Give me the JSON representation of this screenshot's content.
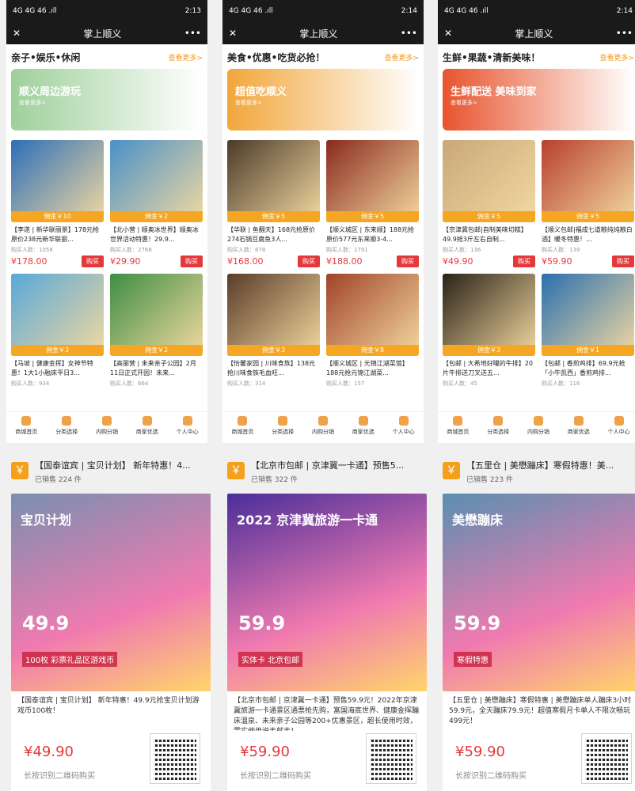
{
  "status_bar": {
    "times": [
      "2:13",
      "2:14",
      "2:14"
    ],
    "signal": "4G 4G 46 .ıll"
  },
  "window": {
    "title": "掌上顺义",
    "close": "✕",
    "more": "•••"
  },
  "columns": [
    {
      "section": "亲子•娱乐•休闲",
      "more": "查看更多>",
      "banner": {
        "title": "顺义周边游玩",
        "sub": "查看更多>",
        "color": "#9ed09a"
      },
      "products": [
        {
          "tag": "佣金￥10",
          "name": "【李遂 | 新华联丽景】178元抢原价238元新华联丽...",
          "sold": "购买人数：1058",
          "price": "¥178.00",
          "buy": "购买",
          "color": "#2c6fb8"
        },
        {
          "tag": "佣金￥2",
          "name": "【北小营 | 顺奥冰世界】顺奥冰世界活动特惠！29.9...",
          "sold": "购买人数：2768",
          "price": "¥29.90",
          "buy": "购买",
          "color": "#4a90c8"
        },
        {
          "tag": "佣金￥3",
          "name": "【马坡 | 健康金挥】女神节特惠！1大1小融床平日3...",
          "sold": "购买人数：934",
          "price": "",
          "buy": "",
          "color": "#58a8d8"
        },
        {
          "tag": "佣金￥2",
          "name": "【高丽营 | 未来亲子公园】2月11日正式开园！未来...",
          "sold": "购买人数：664",
          "price": "",
          "buy": "",
          "color": "#3e8e44"
        }
      ]
    },
    {
      "section": "美食•优惠•吃货必抢！",
      "more": "查看更多>",
      "banner": {
        "title": "超值吃顺义",
        "sub": "查看更多>",
        "color": "#f2a63b"
      },
      "products": [
        {
          "tag": "佣金￥5",
          "name": "【华联 | 鱼翻天】168元抢原价274石锅豆腐鱼3人...",
          "sold": "购买人数：678",
          "price": "¥168.00",
          "buy": "购买",
          "color": "#4b3a2a"
        },
        {
          "tag": "佣金￥5",
          "name": "【顺义城区 | 东来顺】188元抢原价577元东来顺3-4...",
          "sold": "购买人数：1791",
          "price": "¥188.00",
          "buy": "购买",
          "color": "#8a2a1e"
        },
        {
          "tag": "佣金￥3",
          "name": "【怡馨家园 | 川味食族】138元抢川味食族毛血旺...",
          "sold": "购买人数：314",
          "price": "",
          "buy": "",
          "color": "#5a3c2a"
        },
        {
          "tag": "佣金￥8",
          "name": "【顺义城区 | 元锦江湖菜馆】188元抢元锦江湖菜...",
          "sold": "购买人数：157",
          "price": "",
          "buy": "",
          "color": "#a0442a"
        }
      ]
    },
    {
      "section": "生鲜•果蔬•清新美味！",
      "more": "查看更多>",
      "banner": {
        "title": "生鲜配送 美味到家",
        "sub": "查看更多>",
        "color": "#e8542e"
      },
      "products": [
        {
          "tag": "佣金￥5",
          "name": "【京津冀包邮|自制美味切糕】49.9抢3斤左右自制...",
          "sold": "购买人数：136",
          "price": "¥49.90",
          "buy": "购买",
          "color": "#c9a77a"
        },
        {
          "tag": "佣金￥5",
          "name": "【顺义包邮|福成七道粮纯纯粮白酒】暖冬特惠！...",
          "sold": "购买人数：139",
          "price": "¥59.90",
          "buy": "购买",
          "color": "#b8402f"
        },
        {
          "tag": "佣金￥3",
          "name": "【包邮 | 大希地好嘬的牛排】20片牛排送刀叉送五...",
          "sold": "购买人数：45",
          "price": "",
          "buy": "",
          "color": "#2a2218"
        },
        {
          "tag": "佣金￥1",
          "name": "【包邮 | 香煎鸡排】69.9元抢「小牛凯西」香煎鸡排...",
          "sold": "购买人数：116",
          "price": "",
          "buy": "",
          "color": "#2a6fb0"
        }
      ]
    }
  ],
  "tabbar": [
    "商城首页",
    "分类选择",
    "内购分销",
    "商家优选",
    "个人中心"
  ],
  "shares": [
    {
      "icon": "￥",
      "title": "【国泰谊宾 | 宝贝计划】 新年特惠！4...",
      "sold": "已销售 224 件",
      "poster_title": "宝贝计划",
      "poster_price": "49.9",
      "poster_note": "100枚 彩票礼品区游戏币",
      "desc": "【国泰谊宾 | 宝贝计划】 新年特惠！49.9元抢宝贝计划游戏币100枚！",
      "price": "¥49.90",
      "scan": "长按识别二维码购买",
      "color": "#7a8fb0"
    },
    {
      "icon": "￥",
      "title": "【北京市包邮 | 京津冀一卡通】预售5...",
      "sold": "已销售 322 件",
      "poster_title": "2022 京津冀旅游一卡通",
      "poster_price": "59.9",
      "poster_note": "实体卡 北京包邮",
      "desc": "【北京市包邮 | 京津冀一卡通】预售59.9元！2022年京津冀旅游一卡通景区通票抢先购，富国海底世界、健康金挥蹦床温泉、未来亲子公园等200+优惠景区，超长使用时效，需实使用说走就走！",
      "price": "¥59.90",
      "scan": "长按识别二维码购买",
      "color": "#4a2e9a"
    },
    {
      "icon": "￥",
      "title": "【五里仓 | 美懋蹦床】寒假特惠！美...",
      "sold": "已销售 223 件",
      "poster_title": "美懋蹦床",
      "poster_price": "59.9",
      "poster_note": "寒假特惠",
      "desc": "【五里仓 | 美懋蹦床】寒假特惠 | 美懋蹦床单人蹦床3小时59.9元，全天蹦床79.9元！超值寒假月卡单人不限次畅玩499元！",
      "price": "¥59.90",
      "scan": "长按识别二维码购买",
      "color": "#5a8fb0"
    }
  ]
}
